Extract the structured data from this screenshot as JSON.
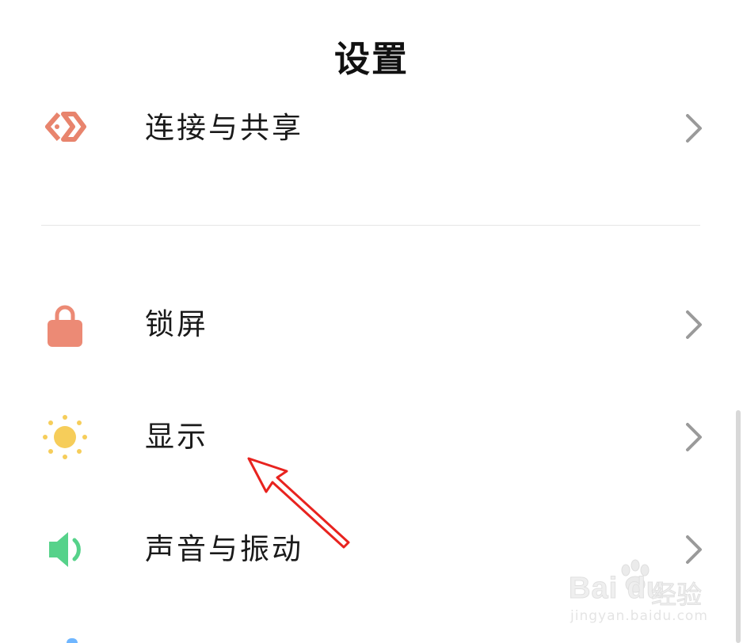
{
  "header": {
    "title": "设置"
  },
  "settings": {
    "items": [
      {
        "label": "连接与共享",
        "icon": "connection-share-icon",
        "icon_color": "#e8846d"
      },
      {
        "label": "锁屏",
        "icon": "lock-icon",
        "icon_color": "#ec8a75"
      },
      {
        "label": "显示",
        "icon": "sun-icon",
        "icon_color": "#f6cd5a"
      },
      {
        "label": "声音与振动",
        "icon": "speaker-icon",
        "icon_color": "#56d28a"
      }
    ]
  },
  "colors": {
    "background": "#ffffff",
    "text": "#1a1a1a",
    "chevron": "#9a9a9a",
    "divider": "#e6e6e6",
    "annotation_arrow": "#e8231f"
  },
  "watermark": {
    "brand": "Bai du",
    "product": "经验",
    "url": "jingyan.baidu.com"
  }
}
